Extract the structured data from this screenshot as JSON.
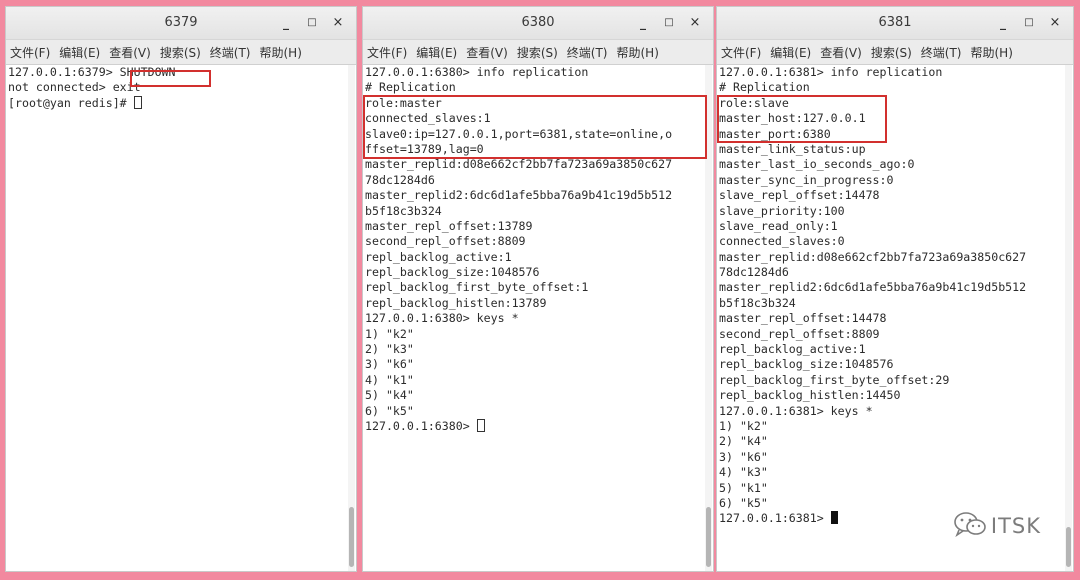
{
  "menu": [
    "文件(F)",
    "编辑(E)",
    "查看(V)",
    "搜索(S)",
    "终端(T)",
    "帮助(H)"
  ],
  "window_controls": {
    "minimize": "_",
    "maximize": "□",
    "close": "×"
  },
  "windows": [
    {
      "title": "6379",
      "lines": [
        "127.0.0.1:6379> SHUTDOWN",
        "not connected> exit",
        "[root@yan redis]# "
      ],
      "cursor_style": "hollow"
    },
    {
      "title": "6380",
      "lines": [
        "127.0.0.1:6380> info replication",
        "# Replication",
        "role:master",
        "connected_slaves:1",
        "slave0:ip=127.0.0.1,port=6381,state=online,o",
        "ffset=13789,lag=0",
        "master_replid:d08e662cf2bb7fa723a69a3850c627",
        "78dc1284d6",
        "master_replid2:6dc6d1afe5bba76a9b41c19d5b512",
        "b5f18c3b324",
        "master_repl_offset:13789",
        "second_repl_offset:8809",
        "repl_backlog_active:1",
        "repl_backlog_size:1048576",
        "repl_backlog_first_byte_offset:1",
        "repl_backlog_histlen:13789",
        "127.0.0.1:6380> keys *",
        "1) \"k2\"",
        "2) \"k3\"",
        "3) \"k6\"",
        "4) \"k1\"",
        "5) \"k4\"",
        "6) \"k5\"",
        "127.0.0.1:6380> "
      ],
      "cursor_style": "hollow"
    },
    {
      "title": "6381",
      "lines": [
        "127.0.0.1:6381> info replication",
        "# Replication",
        "role:slave",
        "master_host:127.0.0.1",
        "master_port:6380",
        "master_link_status:up",
        "master_last_io_seconds_ago:0",
        "master_sync_in_progress:0",
        "slave_repl_offset:14478",
        "slave_priority:100",
        "slave_read_only:1",
        "connected_slaves:0",
        "master_replid:d08e662cf2bb7fa723a69a3850c627",
        "78dc1284d6",
        "master_replid2:6dc6d1afe5bba76a9b41c19d5b512",
        "b5f18c3b324",
        "master_repl_offset:14478",
        "second_repl_offset:8809",
        "repl_backlog_active:1",
        "repl_backlog_size:1048576",
        "repl_backlog_first_byte_offset:29",
        "repl_backlog_histlen:14450",
        "127.0.0.1:6381> keys *",
        "1) \"k2\"",
        "2) \"k4\"",
        "3) \"k6\"",
        "4) \"k3\"",
        "5) \"k1\"",
        "6) \"k5\"",
        "127.0.0.1:6381> "
      ],
      "cursor_style": "solid"
    }
  ],
  "highlight_color": "#d2302e",
  "watermark": {
    "text": "ITSK",
    "icon": "wechat-icon"
  }
}
